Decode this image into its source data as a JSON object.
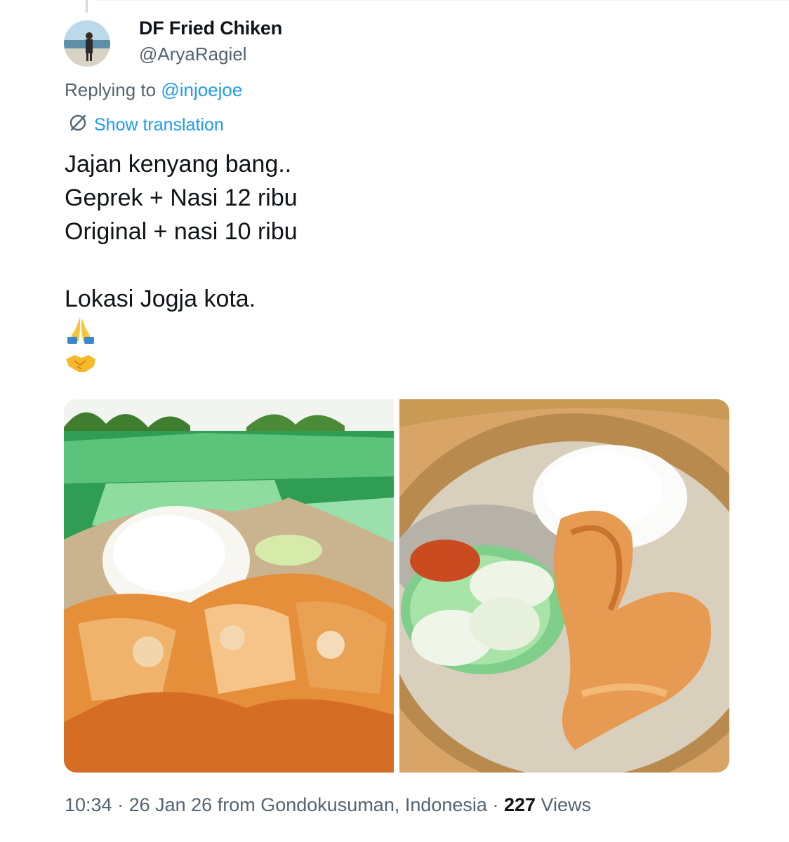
{
  "tweet": {
    "display_name": "DF Fried Chiken",
    "handle": "@AryaRagiel",
    "replying_prefix": "Replying to",
    "replying_to": "@injoejoe",
    "show_translation": "Show translation",
    "text_lines": "Jajan kenyang bang..\nGeprek + Nasi 12 ribu\nOriginal + nasi 10 ribu\n\nLokasi Jogja kota.",
    "emojis": [
      "folded-hands-icon",
      "handshake-icon"
    ],
    "time": "10:34",
    "separator": " · ",
    "date": "26 Jan 26",
    "source_prefix": "from",
    "location": "Gondokusuman, Indonesia",
    "views_count": "227",
    "views_label": "Views"
  },
  "media": [
    {
      "name": "ayam-geprek-photo"
    },
    {
      "name": "fried-chicken-rice-photo"
    }
  ],
  "colors": {
    "link": "#1d9bf0",
    "secondary_text": "#536471",
    "primary_text": "#0f1419"
  }
}
